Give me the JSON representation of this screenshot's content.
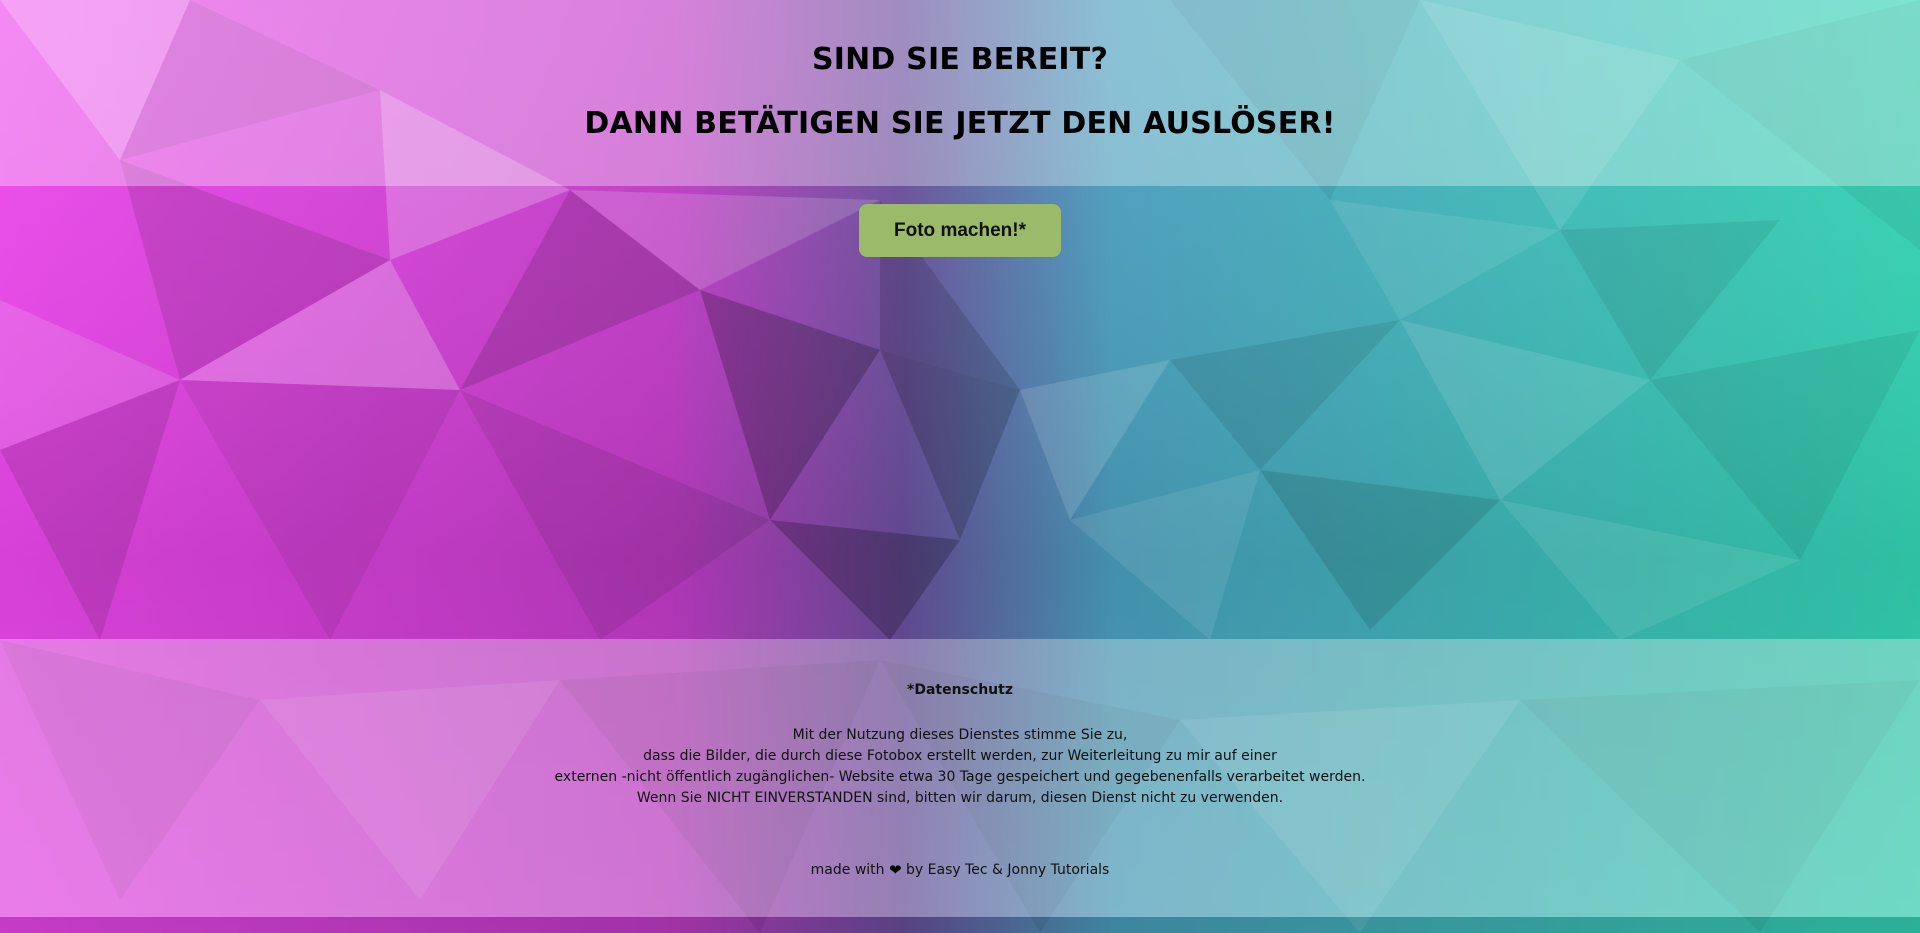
{
  "header": {
    "line1": "SIND SIE BEREIT?",
    "line2": "DANN BETÄTIGEN SIE JETZT DEN AUSLÖSER!"
  },
  "action": {
    "button_label": "Foto machen!*"
  },
  "privacy": {
    "title": "*Datenschutz",
    "lines": [
      "Mit der Nutzung dieses Dienstes stimme Sie zu,",
      "dass die Bilder, die durch diese Fotobox erstellt werden, zur Weiterleitung zu mir auf einer",
      "externen -nicht öffentlich zugänglichen- Website etwa 30 Tage gespeichert und gegebenenfalls verarbeitet werden.",
      "Wenn Sie NICHT EINVERSTANDEN sind, bitten wir darum, diesen Dienst nicht zu verwenden."
    ]
  },
  "credits": {
    "prefix": "made with",
    "icon": "heart-icon",
    "suffix": "by Easy Tec & Jonny Tutorials"
  },
  "colors": {
    "button_bg": "#9bbb6a",
    "gradient_left": "#e83fe8",
    "gradient_mid": "#5a4a9a",
    "gradient_right": "#3fd6b8"
  }
}
